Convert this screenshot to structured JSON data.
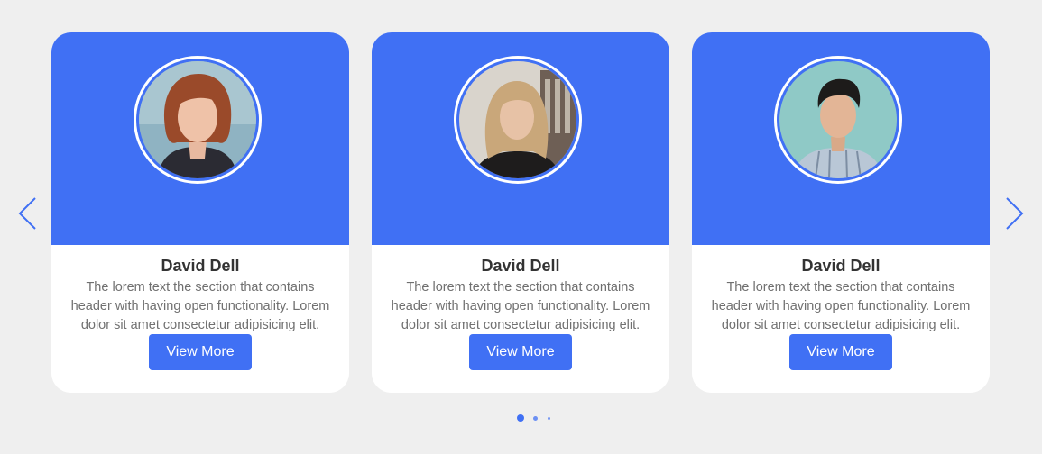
{
  "colors": {
    "accent": "#4070f4",
    "background": "#efefef",
    "card": "#ffffff"
  },
  "cards": [
    {
      "name": "David Dell",
      "description": "The lorem text the section that contains header with having open functionality. Lorem dolor sit amet consectetur adipisicing elit.",
      "button_label": "View More",
      "photo": "woman-red-hair-avatar"
    },
    {
      "name": "David Dell",
      "description": "The lorem text the section that contains header with having open functionality. Lorem dolor sit amet consectetur adipisicing elit.",
      "button_label": "View More",
      "photo": "woman-blonde-hair-avatar"
    },
    {
      "name": "David Dell",
      "description": "The lorem text the section that contains header with having open functionality. Lorem dolor sit amet consectetur adipisicing elit.",
      "button_label": "View More",
      "photo": "man-striped-shirt-avatar"
    }
  ],
  "navigation": {
    "prev_icon": "chevron-left-icon",
    "next_icon": "chevron-right-icon"
  },
  "pagination": {
    "page_count": 3,
    "active_index": 0
  }
}
